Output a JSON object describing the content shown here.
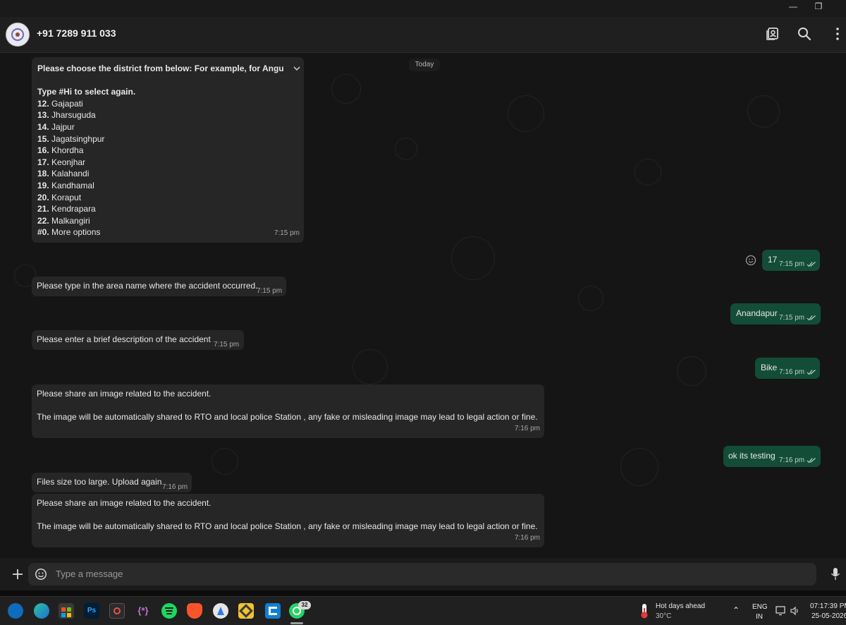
{
  "header": {
    "contact": "+91 7289 911 033",
    "icons": [
      "contact-card-icon",
      "search-icon",
      "kebab-menu-icon"
    ]
  },
  "chat": {
    "date_chip": "Today",
    "messages": [
      {
        "dir": "in",
        "lines": [
          {
            "bold": "",
            "text": "Please choose the district from below: For example, for Angul type"
          },
          {
            "bold": "",
            "text": ""
          },
          {
            "bold": "",
            "text": "Type #Hi to select again."
          },
          {
            "bold": "12.",
            "text": " Gajapati"
          },
          {
            "bold": "13.",
            "text": " Jharsuguda"
          },
          {
            "bold": "14.",
            "text": " Jajpur"
          },
          {
            "bold": "15.",
            "text": " Jagatsinghpur"
          },
          {
            "bold": "16.",
            "text": " Khordha"
          },
          {
            "bold": "17.",
            "text": " Keonjhar"
          },
          {
            "bold": "18.",
            "text": " Kalahandi"
          },
          {
            "bold": "19.",
            "text": " Kandhamal"
          },
          {
            "bold": "20.",
            "text": " Koraput"
          },
          {
            "bold": "21.",
            "text": " Kendrapara"
          },
          {
            "bold": "22.",
            "text": " Malkangiri"
          },
          {
            "bold": "#0.",
            "text": " More options"
          }
        ],
        "time": "7:15 pm"
      },
      {
        "dir": "out",
        "text": "17",
        "time": "7:15 pm"
      },
      {
        "dir": "in",
        "text": "Please type in the area name where the accident occurred.",
        "time": "7:15 pm"
      },
      {
        "dir": "out",
        "text": "Anandapur",
        "time": "7:15 pm"
      },
      {
        "dir": "in",
        "text": "Please enter a brief description of the accident",
        "time": "7:15 pm"
      },
      {
        "dir": "out",
        "text": "Bike",
        "time": "7:16 pm"
      },
      {
        "dir": "in",
        "line1": "Please share an image related to the accident.",
        "line2": "The image will be automatically shared to RTO and local police Station , any fake or misleading image may lead to legal action or fine.",
        "time": "7:16 pm"
      },
      {
        "dir": "out",
        "text": "ok its testing",
        "time": "7:16 pm"
      },
      {
        "dir": "in",
        "text": "Files size too large. Upload again",
        "time": "7:16 pm"
      },
      {
        "dir": "in",
        "line1": "Please share an image related to the accident.",
        "line2": "The image will be automatically shared to RTO and local police Station , any fake or misleading image may lead to legal action or fine.",
        "time": "7:16 pm"
      }
    ]
  },
  "composer": {
    "placeholder": "Type a message",
    "icons": [
      "plus-icon",
      "sticker-icon",
      "microphone-icon"
    ]
  },
  "taskbar": {
    "apps": [
      "outlook-icon",
      "edge-icon",
      "store-icon",
      "photoshop-icon",
      "davinci-icon",
      "code-snippets-icon",
      "spotify-icon",
      "brave-icon",
      "app-icon",
      "git-tool-icon",
      "vscode-icon",
      "whatsapp-icon"
    ],
    "photoshop_label": "Ps",
    "snippets_label": "{*}",
    "whatsapp_badge": "32",
    "weather_title": "Hot days ahead",
    "weather_temp": "30°C",
    "lang_top": "ENG",
    "lang_bottom": "IN",
    "clock_time": "07:17:39 PM",
    "clock_date": "25-05-2026",
    "accent": "#25d366"
  }
}
